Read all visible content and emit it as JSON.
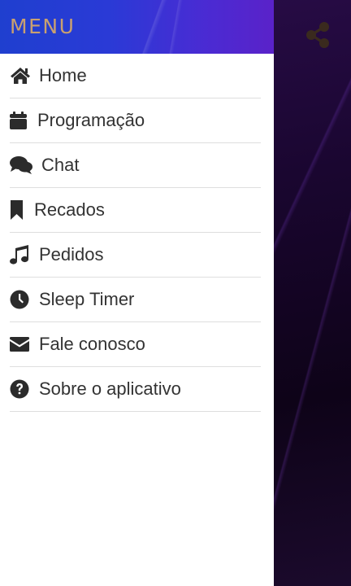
{
  "drawer": {
    "title": "MENU",
    "items": [
      {
        "label": "Home",
        "icon": "home-icon"
      },
      {
        "label": "Programação",
        "icon": "calendar-icon"
      },
      {
        "label": "Chat",
        "icon": "chat-icon"
      },
      {
        "label": "Recados",
        "icon": "bookmark-icon"
      },
      {
        "label": "Pedidos",
        "icon": "music-icon"
      },
      {
        "label": "Sleep Timer",
        "icon": "clock-icon"
      },
      {
        "label": "Fale conosco",
        "icon": "envelope-icon"
      },
      {
        "label": "Sobre o aplicativo",
        "icon": "question-icon"
      }
    ]
  },
  "colors": {
    "header_start": "#1f3fcf",
    "header_end": "#5a22c9",
    "title": "#c9a070",
    "text": "#333333",
    "icon": "#2b2b2b",
    "divider": "#dedede",
    "background_app": "#1a0630",
    "share_icon": "#3a2a1e"
  },
  "app": {
    "share_icon": "share-icon"
  }
}
